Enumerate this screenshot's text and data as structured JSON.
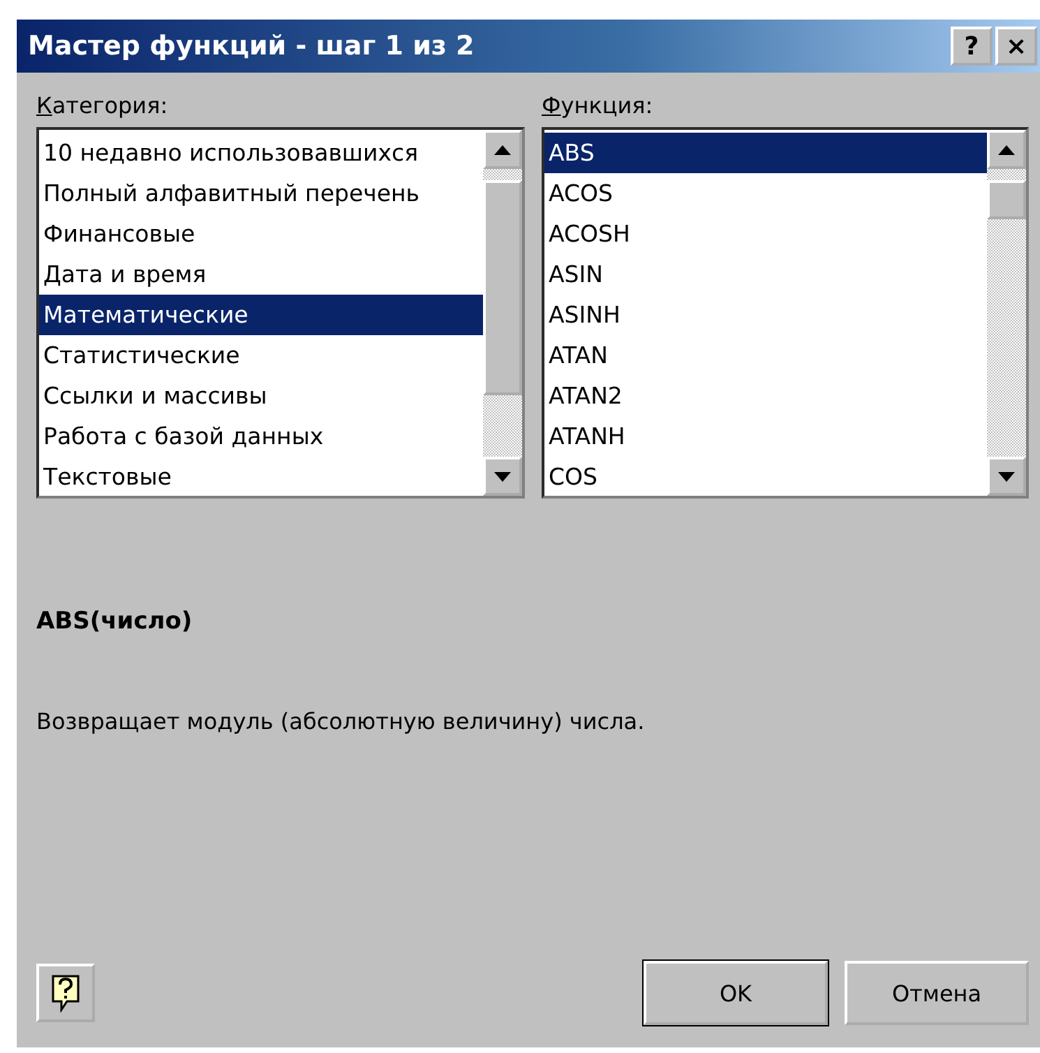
{
  "window": {
    "title": "Мастер функций - шаг 1 из 2",
    "title_buttons": [
      "?",
      "×"
    ]
  },
  "category": {
    "label": "Категория:",
    "items": [
      {
        "text": "10 недавно использовавшихся",
        "selected": false
      },
      {
        "text": "Полный алфавитный перечень",
        "selected": false
      },
      {
        "text": "Финансовые",
        "selected": false
      },
      {
        "text": "Дата и время",
        "selected": false
      },
      {
        "text": "Математические",
        "selected": true
      },
      {
        "text": "Статистические",
        "selected": false
      },
      {
        "text": "Ссылки и массивы",
        "selected": false
      },
      {
        "text": "Работа с базой данных",
        "selected": false
      },
      {
        "text": "Текстовые",
        "selected": false
      }
    ]
  },
  "function": {
    "label": "Функция:",
    "items": [
      {
        "text": "ABS",
        "selected": true
      },
      {
        "text": "ACOS",
        "selected": false
      },
      {
        "text": "ACOSH",
        "selected": false
      },
      {
        "text": "ASIN",
        "selected": false
      },
      {
        "text": "ASINH",
        "selected": false
      },
      {
        "text": "ATAN",
        "selected": false
      },
      {
        "text": "ATAN2",
        "selected": false
      },
      {
        "text": "ATANH",
        "selected": false
      },
      {
        "text": "COS",
        "selected": false
      }
    ]
  },
  "syntax": "ABS(число)",
  "description": "Возвращает модуль (абсолютную величину) числа.",
  "buttons": [
    "OK",
    "Отмена"
  ]
}
